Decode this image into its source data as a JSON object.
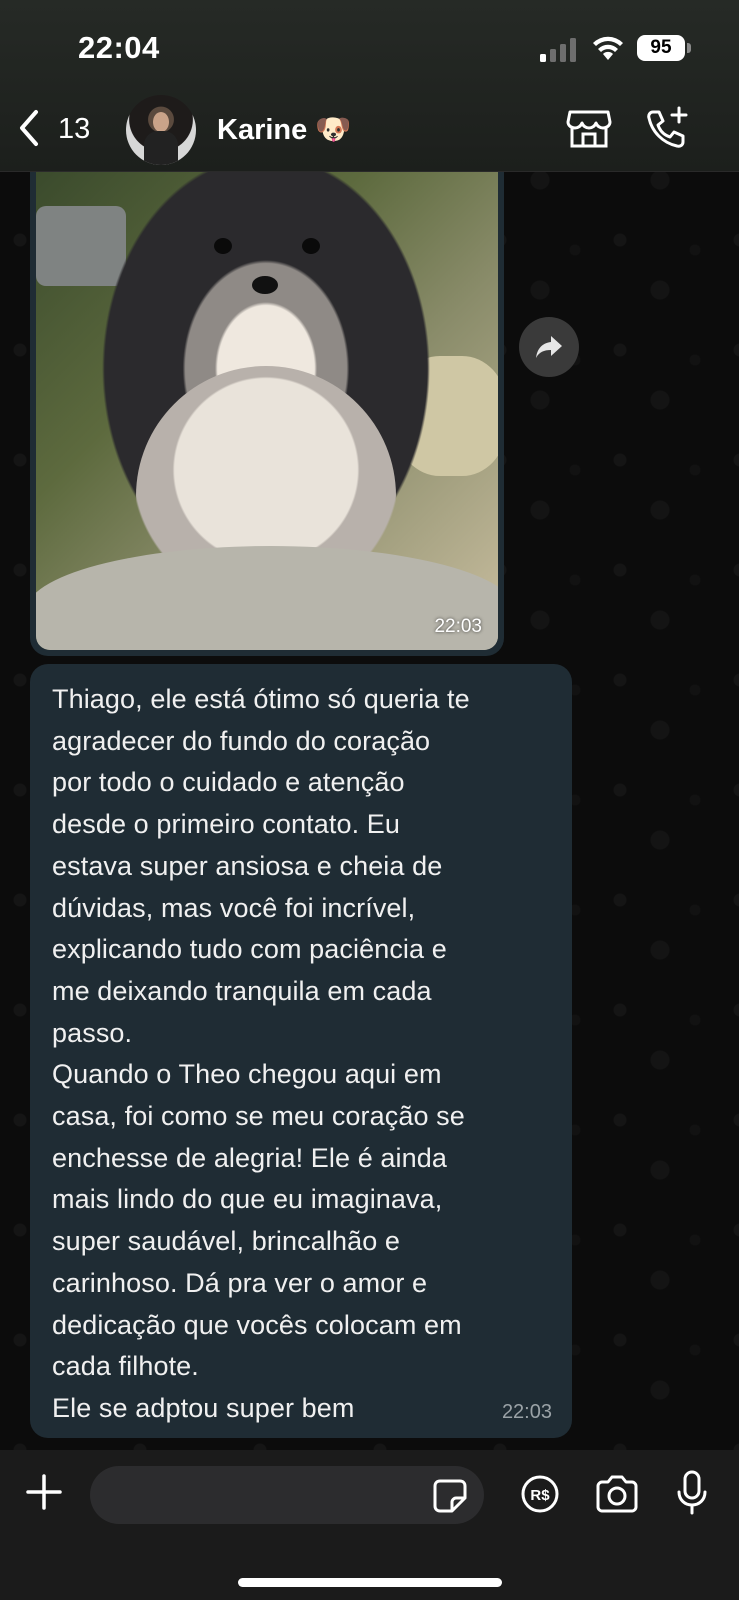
{
  "status_bar": {
    "time": "22:04",
    "battery_level": "95",
    "signal_icon": "signal-bars-icon",
    "wifi_icon": "wifi-icon"
  },
  "header": {
    "back_count": "13",
    "contact_name": "Karine 🐶",
    "back_icon": "chevron-left-icon",
    "store_icon": "store-icon",
    "call_icon": "add-call-icon"
  },
  "messages": [
    {
      "type": "image",
      "timestamp": "22:03",
      "image_description_icon": "photo"
    },
    {
      "type": "text",
      "text": "Thiago, ele está ótimo só queria te\nagradecer do fundo do coração\npor todo o cuidado e atenção\ndesde o primeiro contato. Eu\nestava super ansiosa e cheia de\ndúvidas, mas você foi incrível,\nexplicando tudo com paciência e\nme deixando tranquila em cada\npasso.\nQuando o Theo chegou aqui em\ncasa, foi como se meu coração se\nenchesse de alegria! Ele é ainda\nmais lindo do que eu imaginava,\nsuper saudável, brincalhão e\ncarinhoso. Dá pra ver o amor e\ndedicação que vocês colocam em\ncada filhote.\nEle se adptou super bem",
      "timestamp": "22:03"
    }
  ],
  "composer": {
    "placeholder": "",
    "icons": [
      "plus-icon",
      "sticker-icon",
      "payment-icon",
      "camera-icon",
      "microphone-icon"
    ]
  },
  "colors": {
    "bubble": "#1f2c34",
    "header_bg": "#1f221f",
    "composer_bg": "#1b1b1b"
  }
}
